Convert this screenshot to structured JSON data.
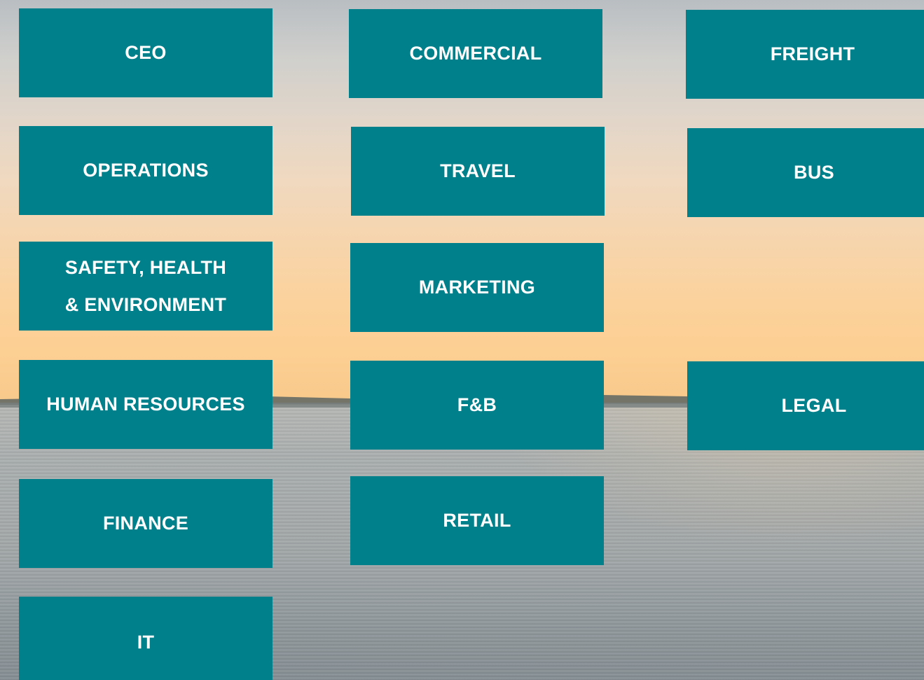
{
  "departments": {
    "col1": [
      {
        "label": "CEO"
      },
      {
        "label": "OPERATIONS"
      },
      {
        "line1": "SAFETY, HEALTH",
        "line2": "& ENVIRONMENT"
      },
      {
        "label": "HUMAN RESOURCES"
      },
      {
        "label": "FINANCE"
      },
      {
        "label": "IT"
      }
    ],
    "col2": [
      {
        "label": "COMMERCIAL"
      },
      {
        "label": "TRAVEL"
      },
      {
        "label": "MARKETING"
      },
      {
        "label": "F&B"
      },
      {
        "label": "RETAIL"
      }
    ],
    "col3": [
      {
        "label": "FREIGHT"
      },
      {
        "label": "BUS"
      },
      {
        "label": "LEGAL"
      }
    ]
  },
  "colors": {
    "tile": "#00808b",
    "tile_text": "#ffffff"
  }
}
